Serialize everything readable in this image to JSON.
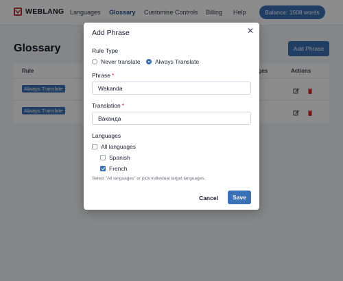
{
  "navbar": {
    "brand": "WEBLANG",
    "links": [
      "Languages",
      "Glossary",
      "Customise Controls",
      "Billing",
      "Help"
    ],
    "active_link": "Glossary",
    "balance": "Balance: 1508 words"
  },
  "page": {
    "title": "Glossary",
    "add_button": "Add Phrase",
    "table": {
      "headers": {
        "rule": "Rule",
        "languages_partial": "ages",
        "actions": "Actions"
      },
      "rows": [
        {
          "rule": "Always Translate"
        },
        {
          "rule": "Always Translate"
        }
      ]
    }
  },
  "modal": {
    "title": "Add Phrase",
    "rule_type_label": "Rule Type",
    "rule_options": [
      "Never translate",
      "Always Translate"
    ],
    "selected_rule": "Always Translate",
    "phrase_label": "Phrase",
    "phrase_value": "Wakanda",
    "translation_label": "Translation",
    "translation_value": "Ваканда",
    "required_marker": "*",
    "languages_label": "Languages",
    "all_languages": {
      "label": "All languages",
      "checked": false
    },
    "languages": [
      {
        "label": "Spanish",
        "checked": false
      },
      {
        "label": "French",
        "checked": true
      }
    ],
    "help_text": "Select \"All languages\" or pick individual target languages.",
    "cancel_label": "Cancel",
    "save_label": "Save"
  },
  "colors": {
    "accent": "#3b6fb6",
    "brand_red": "#c0323b",
    "delete_red": "#dc2626"
  }
}
